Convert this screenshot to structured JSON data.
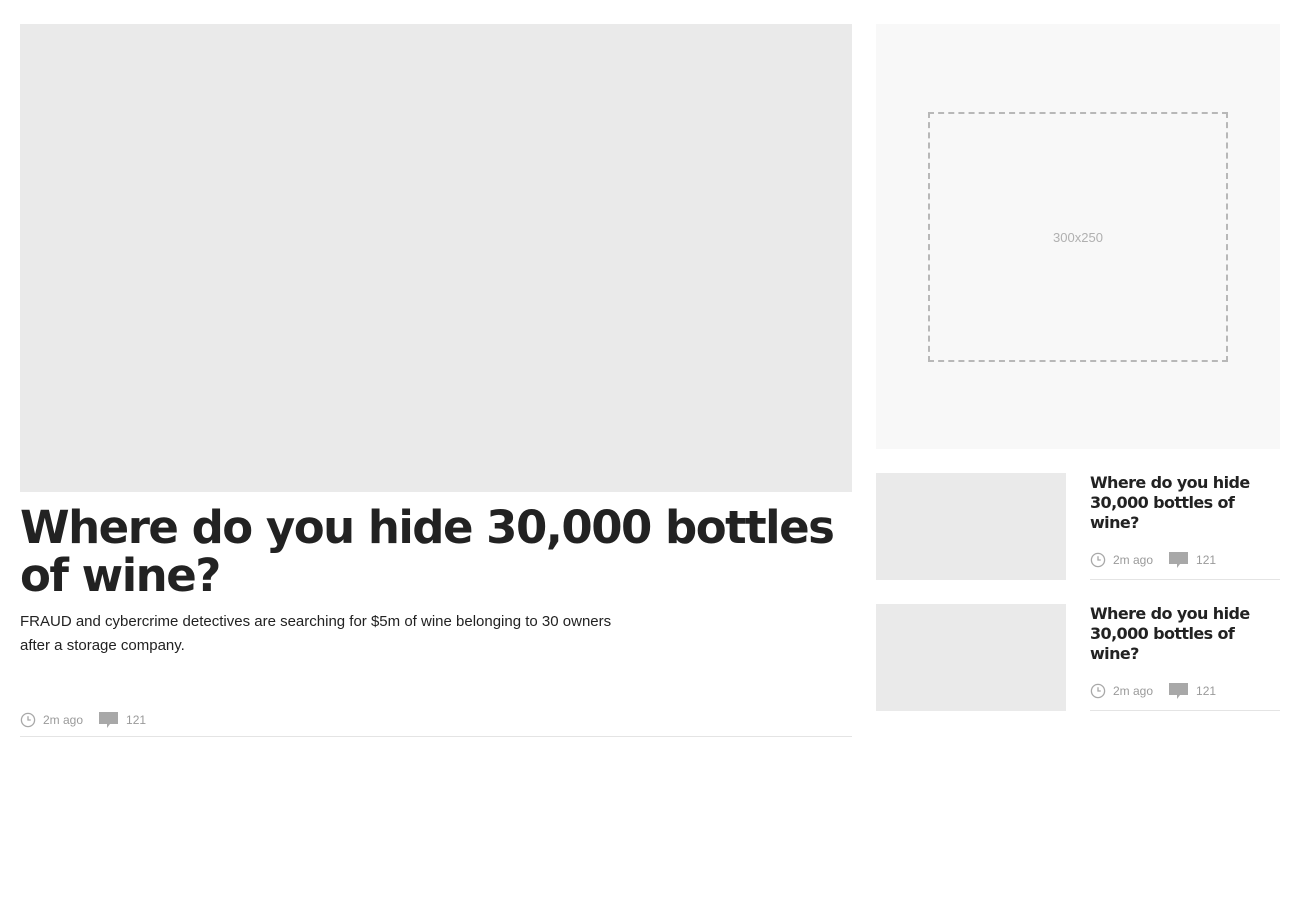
{
  "lead_story": {
    "headline": "Where do you hide 30,000 bottles of wine?",
    "standfirst": "FRAUD and cybercrime detectives are searching for $5m of wine belonging to 30 owners after a storage company.",
    "time": "2m ago",
    "comment_count": "121"
  },
  "advert": {
    "label": "300x250"
  },
  "side_stories": [
    {
      "headline": "Where do you hide 30,000 bottles of wine?",
      "time": "2m ago",
      "comment_count": "121"
    },
    {
      "headline": "Where do you hide 30,000 bottles of wine?",
      "time": "2m ago",
      "comment_count": "121"
    }
  ],
  "icons": {
    "time": "clock-icon",
    "comments": "comment-bubble-icon"
  },
  "colors": {
    "placeholder": "#eaeaea",
    "ad_background": "#f8f8f8",
    "meta_text": "#9a9a9a",
    "headline": "#222222"
  }
}
